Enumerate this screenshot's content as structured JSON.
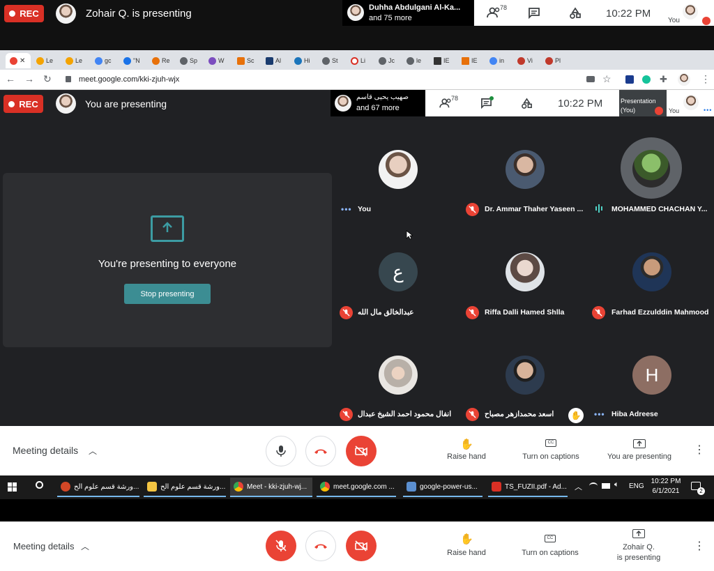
{
  "outer_top": {
    "rec_label": "REC",
    "presenter_text": "Zohair Q. is presenting",
    "participants_line1": "Duhha Abdulgani Al-Ka...",
    "participants_line2": "and 75 more",
    "people_count": "78",
    "time": "10:22 PM",
    "you_label": "You"
  },
  "browser": {
    "tabs": [
      "Le",
      "Le",
      "gc",
      "\"N",
      "Re",
      "Sp",
      "W",
      "Sc",
      "Al",
      "Hi",
      "St",
      "Li",
      "Jc",
      "le",
      "IE",
      "IE",
      "in",
      "Vi",
      "Pl"
    ],
    "url": "meet.google.com/kki-zjuh-wjx"
  },
  "inner_top": {
    "rec_label": "REC",
    "presenter_text": "You are presenting",
    "participants_line1": "صهيب يحيى قاسم",
    "participants_line2": "and 67 more",
    "people_count": "78",
    "time": "10:22 PM",
    "presentation_label_1": "Presentation",
    "presentation_label_2": "(You)",
    "you_label": "You"
  },
  "presenting_panel": {
    "message": "You're presenting to everyone",
    "stop_button": "Stop presenting"
  },
  "participants": [
    {
      "name": "You",
      "status": "dots"
    },
    {
      "name": "Dr. Ammar Thaher Yaseen ...",
      "status": "muted"
    },
    {
      "name": "MOHAMMED CHACHAN Y...",
      "status": "speaking"
    },
    {
      "name": "عبدالخالق مال الله",
      "status": "muted",
      "initial": "ع"
    },
    {
      "name": "Riffa Dalli Hamed Shlla",
      "status": "muted"
    },
    {
      "name": "Farhad Ezzulddin Mahmood",
      "status": "muted"
    },
    {
      "name": "انفال محمود احمد الشيخ عبدال",
      "status": "muted"
    },
    {
      "name": "اسعد محمدازهر مصباح",
      "status": "muted"
    },
    {
      "name": "Hiba Adreese",
      "status": "dots",
      "initial": "H"
    }
  ],
  "inner_controls": {
    "meeting_details": "Meeting details",
    "raise_hand": "Raise hand",
    "captions": "Turn on captions",
    "presenting": "You are presenting"
  },
  "taskbar": {
    "items": [
      "ورشة قسم علوم الح...",
      "ورشة قسم علوم الح...",
      "Meet - kki-zjuh-wj...",
      "meet.google.com ...",
      "google-power-us...",
      "TS_FUZII.pdf - Ad..."
    ],
    "lang": "ENG",
    "time": "10:22 PM",
    "date": "6/1/2021",
    "notif_count": "2"
  },
  "outer_controls": {
    "meeting_details": "Meeting details",
    "raise_hand": "Raise hand",
    "captions": "Turn on captions",
    "presenting_1": "Zohair Q.",
    "presenting_2": "is presenting"
  },
  "colors": {
    "rec": "#d93025",
    "meet_bg": "#202124",
    "hangup_red": "#ea4335",
    "teal": "#3c8d93"
  }
}
